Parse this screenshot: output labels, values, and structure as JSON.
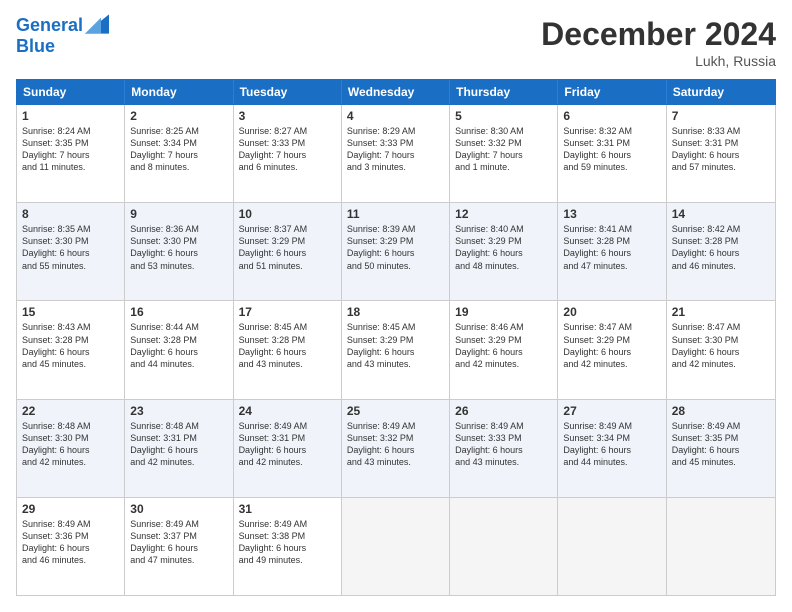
{
  "header": {
    "logo_line1": "General",
    "logo_line2": "Blue",
    "title": "December 2024",
    "subtitle": "Lukh, Russia"
  },
  "days": [
    "Sunday",
    "Monday",
    "Tuesday",
    "Wednesday",
    "Thursday",
    "Friday",
    "Saturday"
  ],
  "rows": [
    [
      {
        "num": "1",
        "lines": [
          "Sunrise: 8:24 AM",
          "Sunset: 3:35 PM",
          "Daylight: 7 hours",
          "and 11 minutes."
        ]
      },
      {
        "num": "2",
        "lines": [
          "Sunrise: 8:25 AM",
          "Sunset: 3:34 PM",
          "Daylight: 7 hours",
          "and 8 minutes."
        ]
      },
      {
        "num": "3",
        "lines": [
          "Sunrise: 8:27 AM",
          "Sunset: 3:33 PM",
          "Daylight: 7 hours",
          "and 6 minutes."
        ]
      },
      {
        "num": "4",
        "lines": [
          "Sunrise: 8:29 AM",
          "Sunset: 3:33 PM",
          "Daylight: 7 hours",
          "and 3 minutes."
        ]
      },
      {
        "num": "5",
        "lines": [
          "Sunrise: 8:30 AM",
          "Sunset: 3:32 PM",
          "Daylight: 7 hours",
          "and 1 minute."
        ]
      },
      {
        "num": "6",
        "lines": [
          "Sunrise: 8:32 AM",
          "Sunset: 3:31 PM",
          "Daylight: 6 hours",
          "and 59 minutes."
        ]
      },
      {
        "num": "7",
        "lines": [
          "Sunrise: 8:33 AM",
          "Sunset: 3:31 PM",
          "Daylight: 6 hours",
          "and 57 minutes."
        ]
      }
    ],
    [
      {
        "num": "8",
        "lines": [
          "Sunrise: 8:35 AM",
          "Sunset: 3:30 PM",
          "Daylight: 6 hours",
          "and 55 minutes."
        ]
      },
      {
        "num": "9",
        "lines": [
          "Sunrise: 8:36 AM",
          "Sunset: 3:30 PM",
          "Daylight: 6 hours",
          "and 53 minutes."
        ]
      },
      {
        "num": "10",
        "lines": [
          "Sunrise: 8:37 AM",
          "Sunset: 3:29 PM",
          "Daylight: 6 hours",
          "and 51 minutes."
        ]
      },
      {
        "num": "11",
        "lines": [
          "Sunrise: 8:39 AM",
          "Sunset: 3:29 PM",
          "Daylight: 6 hours",
          "and 50 minutes."
        ]
      },
      {
        "num": "12",
        "lines": [
          "Sunrise: 8:40 AM",
          "Sunset: 3:29 PM",
          "Daylight: 6 hours",
          "and 48 minutes."
        ]
      },
      {
        "num": "13",
        "lines": [
          "Sunrise: 8:41 AM",
          "Sunset: 3:28 PM",
          "Daylight: 6 hours",
          "and 47 minutes."
        ]
      },
      {
        "num": "14",
        "lines": [
          "Sunrise: 8:42 AM",
          "Sunset: 3:28 PM",
          "Daylight: 6 hours",
          "and 46 minutes."
        ]
      }
    ],
    [
      {
        "num": "15",
        "lines": [
          "Sunrise: 8:43 AM",
          "Sunset: 3:28 PM",
          "Daylight: 6 hours",
          "and 45 minutes."
        ]
      },
      {
        "num": "16",
        "lines": [
          "Sunrise: 8:44 AM",
          "Sunset: 3:28 PM",
          "Daylight: 6 hours",
          "and 44 minutes."
        ]
      },
      {
        "num": "17",
        "lines": [
          "Sunrise: 8:45 AM",
          "Sunset: 3:28 PM",
          "Daylight: 6 hours",
          "and 43 minutes."
        ]
      },
      {
        "num": "18",
        "lines": [
          "Sunrise: 8:45 AM",
          "Sunset: 3:29 PM",
          "Daylight: 6 hours",
          "and 43 minutes."
        ]
      },
      {
        "num": "19",
        "lines": [
          "Sunrise: 8:46 AM",
          "Sunset: 3:29 PM",
          "Daylight: 6 hours",
          "and 42 minutes."
        ]
      },
      {
        "num": "20",
        "lines": [
          "Sunrise: 8:47 AM",
          "Sunset: 3:29 PM",
          "Daylight: 6 hours",
          "and 42 minutes."
        ]
      },
      {
        "num": "21",
        "lines": [
          "Sunrise: 8:47 AM",
          "Sunset: 3:30 PM",
          "Daylight: 6 hours",
          "and 42 minutes."
        ]
      }
    ],
    [
      {
        "num": "22",
        "lines": [
          "Sunrise: 8:48 AM",
          "Sunset: 3:30 PM",
          "Daylight: 6 hours",
          "and 42 minutes."
        ]
      },
      {
        "num": "23",
        "lines": [
          "Sunrise: 8:48 AM",
          "Sunset: 3:31 PM",
          "Daylight: 6 hours",
          "and 42 minutes."
        ]
      },
      {
        "num": "24",
        "lines": [
          "Sunrise: 8:49 AM",
          "Sunset: 3:31 PM",
          "Daylight: 6 hours",
          "and 42 minutes."
        ]
      },
      {
        "num": "25",
        "lines": [
          "Sunrise: 8:49 AM",
          "Sunset: 3:32 PM",
          "Daylight: 6 hours",
          "and 43 minutes."
        ]
      },
      {
        "num": "26",
        "lines": [
          "Sunrise: 8:49 AM",
          "Sunset: 3:33 PM",
          "Daylight: 6 hours",
          "and 43 minutes."
        ]
      },
      {
        "num": "27",
        "lines": [
          "Sunrise: 8:49 AM",
          "Sunset: 3:34 PM",
          "Daylight: 6 hours",
          "and 44 minutes."
        ]
      },
      {
        "num": "28",
        "lines": [
          "Sunrise: 8:49 AM",
          "Sunset: 3:35 PM",
          "Daylight: 6 hours",
          "and 45 minutes."
        ]
      }
    ],
    [
      {
        "num": "29",
        "lines": [
          "Sunrise: 8:49 AM",
          "Sunset: 3:36 PM",
          "Daylight: 6 hours",
          "and 46 minutes."
        ]
      },
      {
        "num": "30",
        "lines": [
          "Sunrise: 8:49 AM",
          "Sunset: 3:37 PM",
          "Daylight: 6 hours",
          "and 47 minutes."
        ]
      },
      {
        "num": "31",
        "lines": [
          "Sunrise: 8:49 AM",
          "Sunset: 3:38 PM",
          "Daylight: 6 hours",
          "and 49 minutes."
        ]
      },
      null,
      null,
      null,
      null
    ]
  ]
}
